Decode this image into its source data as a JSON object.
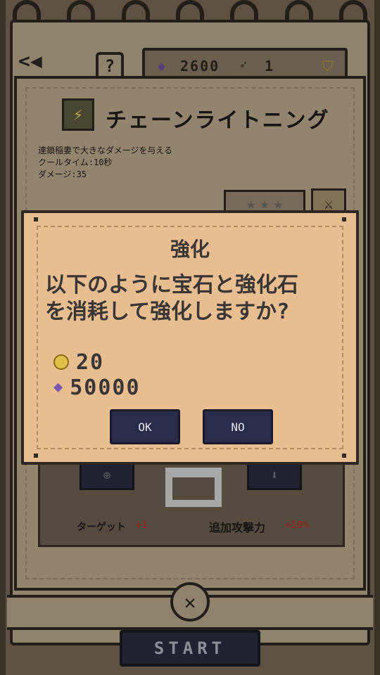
{
  "hud": {
    "back_icon": "back-arrow-icon",
    "help_label": "?",
    "gems": "2600",
    "feathers": "1",
    "gem_icon": "purple-gem-icon",
    "feather_icon": "feather-icon",
    "shield_icon": "gold-shield-icon"
  },
  "skill": {
    "title": "チェーンライトニング",
    "description_line1": "連鎖稲妻で大きなダメージを与える",
    "description_line2": "クールタイム:10秒",
    "description_line3": "ダメージ:35",
    "stars": [
      "★",
      "★",
      "★"
    ],
    "icon": "lightning-chain-icon"
  },
  "stats": {
    "target_label": "ターゲット",
    "target_value": "+1",
    "attack_label": "追加攻撃力",
    "attack_value": "+10%"
  },
  "dialog": {
    "title": "強化",
    "message_line1": "以下のように宝石と強化石",
    "message_line2": "を消耗して強化しますか?",
    "cost_coin": "20",
    "cost_gem": "50000",
    "ok_label": "OK",
    "no_label": "NO"
  },
  "footer": {
    "close_label": "✕",
    "start_label": "START"
  }
}
